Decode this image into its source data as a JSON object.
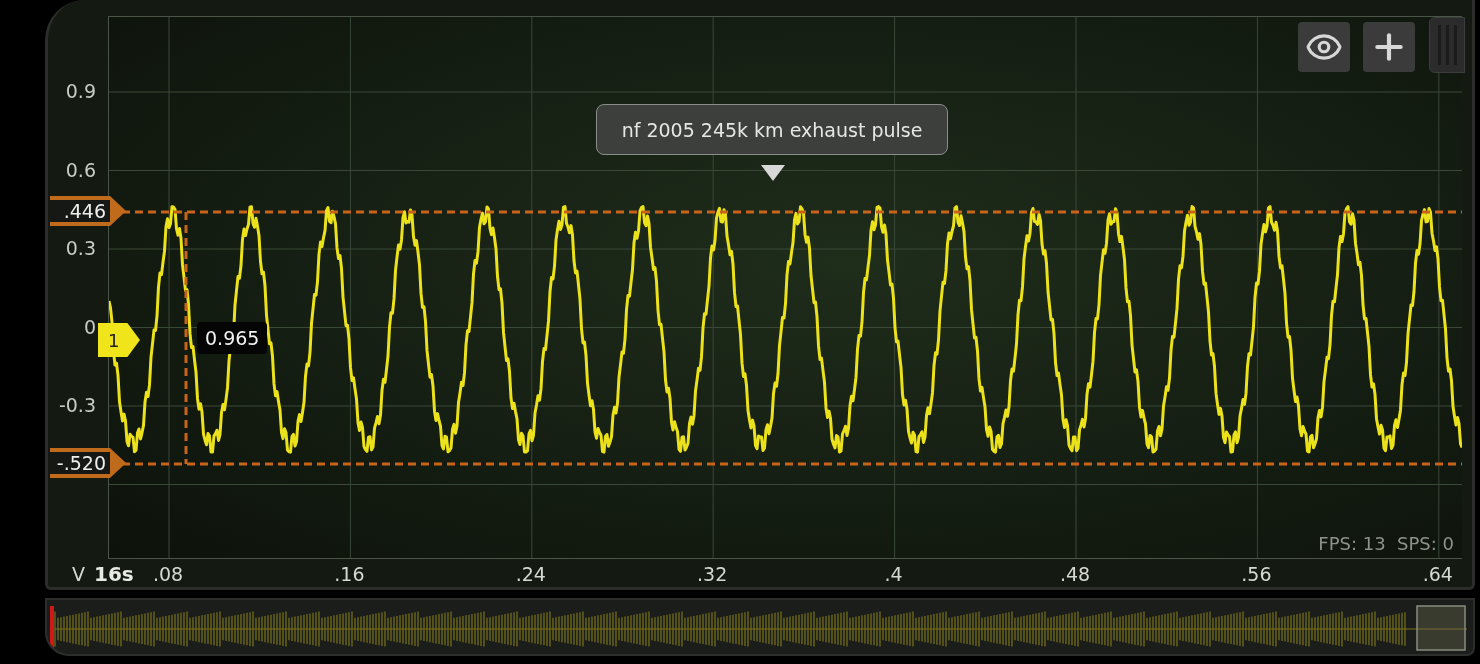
{
  "annotation": {
    "text": "nf 2005 245k km exhaust pulse"
  },
  "y_axis": {
    "labels": [
      "0.9",
      "0.6",
      "0.3",
      "0",
      "-0.3"
    ]
  },
  "cursors": [
    {
      "label": ".446"
    },
    {
      "label": "-.520"
    }
  ],
  "channel": {
    "number": "1",
    "reading": "0.965"
  },
  "x_axis": {
    "unit": "V",
    "timebase": "16s",
    "labels": [
      ".08",
      ".16",
      ".24",
      ".32",
      ".4",
      ".48",
      ".56",
      ".64"
    ]
  },
  "status": {
    "text": "FPS: 13  SPS: 0"
  }
}
